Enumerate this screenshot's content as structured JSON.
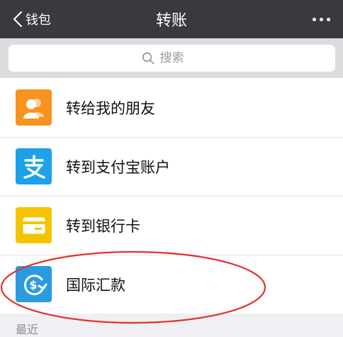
{
  "navbar": {
    "back_label": "钱包",
    "title": "转账"
  },
  "search": {
    "placeholder": "搜索"
  },
  "items": [
    {
      "label": "转给我的朋友",
      "icon": "friends-icon",
      "color": "#f7931e"
    },
    {
      "label": "转到支付宝账户",
      "icon": "alipay-icon",
      "color": "#1da1e8"
    },
    {
      "label": "转到银行卡",
      "icon": "bank-card-icon",
      "color": "#f5c400"
    },
    {
      "label": "国际汇款",
      "icon": "international-remittance-icon",
      "color": "#2a9be0"
    }
  ],
  "section": {
    "recent_label": "最近"
  },
  "annotation": {
    "color": "#e0332b"
  }
}
